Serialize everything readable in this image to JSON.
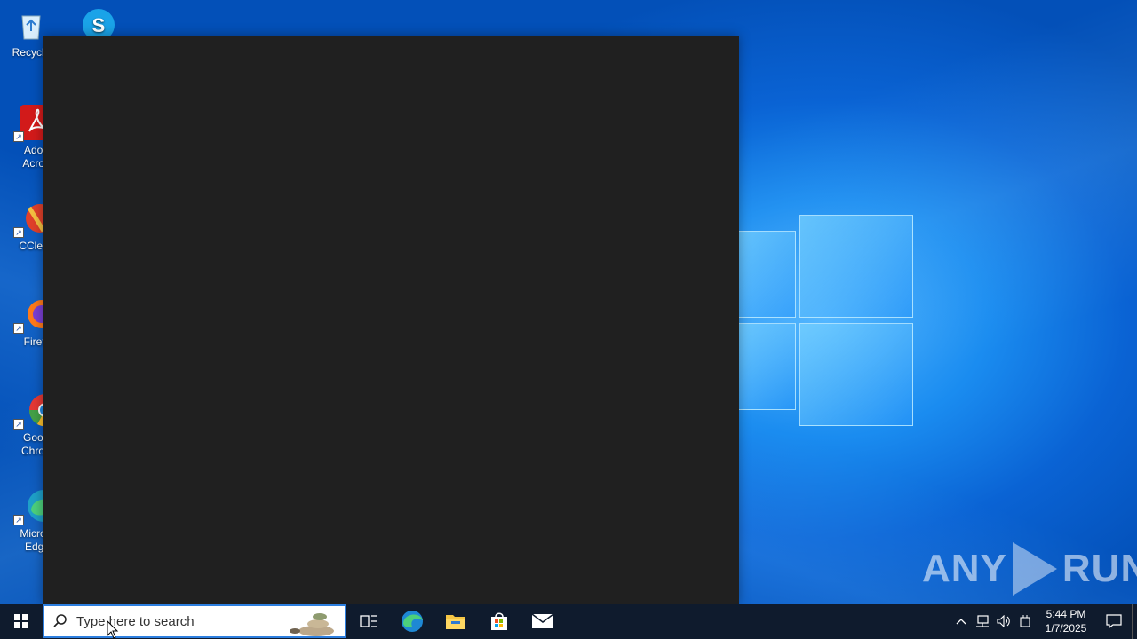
{
  "desktop": {
    "icons": [
      {
        "label": "Recycle",
        "icon": "recycle-bin-icon"
      },
      {
        "label": "",
        "icon": "skype-icon"
      },
      {
        "label": "Adob Acrob",
        "line1": "Adob",
        "line2": "Acrob",
        "icon": "adobe-acrobat-icon"
      },
      {
        "label": "CClear",
        "icon": "ccleaner-icon"
      },
      {
        "label": "Firefo",
        "icon": "firefox-icon"
      },
      {
        "label": "Googl Chrom",
        "line1": "Googl",
        "line2": "Chrom",
        "icon": "chrome-icon"
      },
      {
        "label": "Micros Edge",
        "line1": "Micros",
        "line2": "Edge",
        "icon": "edge-icon"
      }
    ]
  },
  "watermark": {
    "left": "ANY",
    "right": "RUN"
  },
  "taskbar": {
    "search_placeholder": "Type here to search",
    "pinned": [
      "task-view-icon",
      "edge-icon",
      "file-explorer-icon",
      "store-icon",
      "mail-icon"
    ],
    "clock": {
      "time": "5:44 PM",
      "date": "1/7/2025"
    }
  },
  "colors": {
    "taskbar": "#0f1b2d",
    "window": "#202020",
    "desktop_accent": "#1a8cf0"
  }
}
